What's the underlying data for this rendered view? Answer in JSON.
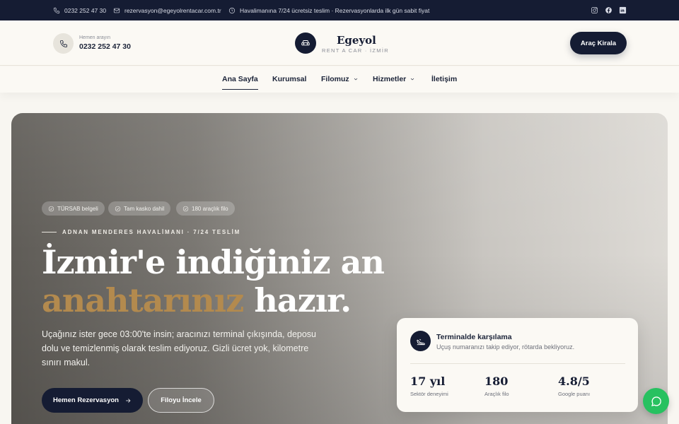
{
  "topbar": {
    "phone": "0232 252 47 30",
    "email": "rezervasyon@egeyolrentacar.com.tr",
    "notice": "Havalimanına 7/24 ücretsiz teslim · Rezervasyonlarda ilk gün sabit fiyat",
    "socials": [
      "instagram-icon",
      "facebook-icon",
      "linkedin-icon"
    ]
  },
  "header": {
    "call_label": "Hemen arayın",
    "call_number": "0232 252 47 30",
    "brand_name": "Egeyol",
    "brand_sub": "RENT A CAR · İZMİR",
    "cta": "Araç Kirala"
  },
  "nav": {
    "items": [
      {
        "label": "Ana Sayfa",
        "active": true
      },
      {
        "label": "Kurumsal"
      },
      {
        "label": "Filomuz",
        "dropdown": true
      },
      {
        "label": "Hizmetler",
        "dropdown": true
      },
      {
        "label": "İletişim"
      }
    ]
  },
  "hero": {
    "chips": [
      "TÜRSAB belgeli",
      "Tam kasko dahil",
      "180 araçlık filo"
    ],
    "eyebrow": "ADNAN MENDERES HAVALİMANI · 7/24 TESLİM",
    "headline_line1": "İzmir'e indiğiniz an",
    "headline_highlight": "anahtarınız",
    "headline_rest": " hazır.",
    "lead": "Uçağınız ister gece 03:00'te insin; aracınızı terminal çıkışında, deposu dolu ve temizlenmiş olarak teslim ediyoruz. Gizli ücret yok, kilometre sınırı makul.",
    "primary_cta": "Hemen Rezervasyon",
    "secondary_cta": "Filoyu İncele"
  },
  "card": {
    "title": "Terminalde karşılama",
    "desc": "Uçuş numaranızı takip ediyor, rötarda bekliyoruz.",
    "stats": [
      {
        "value": "17 yıl",
        "label": "Sektör deneyimi"
      },
      {
        "value": "180",
        "label": "Araçlık filo"
      },
      {
        "value": "4.8/5",
        "label": "Google puanı"
      }
    ]
  },
  "colors": {
    "navy": "#151c33",
    "gold": "#b38a4e",
    "whatsapp": "#27c160",
    "cream": "#fbf9f4"
  }
}
